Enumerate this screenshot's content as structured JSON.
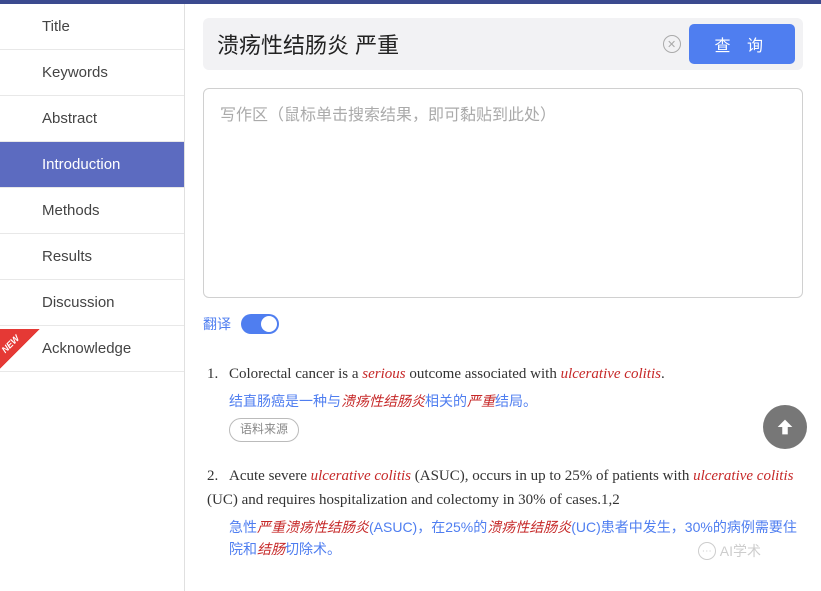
{
  "sidebar": {
    "items": [
      {
        "label": "Title"
      },
      {
        "label": "Keywords"
      },
      {
        "label": "Abstract"
      },
      {
        "label": "Introduction"
      },
      {
        "label": "Methods"
      },
      {
        "label": "Results"
      },
      {
        "label": "Discussion"
      },
      {
        "label": "Acknowledge"
      }
    ],
    "new_badge": "NEW"
  },
  "search": {
    "value": "溃疡性结肠炎 严重",
    "query_btn": "查 询"
  },
  "writearea": {
    "placeholder": "写作区（鼠标单击搜索结果，即可黏贴到此处）"
  },
  "translate": {
    "label": "翻译",
    "on": true
  },
  "source_btn": "语料来源",
  "results": [
    {
      "num": "1.",
      "en_parts": [
        "Colorectal cancer is a ",
        "serious",
        " outcome associated with ",
        "ulcerative colitis",
        "."
      ],
      "en_hl": [
        false,
        true,
        false,
        true,
        false
      ],
      "cn_parts": [
        "结直肠癌是一种与",
        "溃疡性结肠炎",
        "相关的",
        "严重",
        "结局。"
      ],
      "cn_hl": [
        false,
        true,
        false,
        true,
        false
      ]
    },
    {
      "num": "2.",
      "en_parts": [
        "Acute severe ",
        "ulcerative colitis",
        " (ASUC), occurs in up to 25% of patients with ",
        "ulcerative colitis",
        " (UC) and requires hospitalization and colectomy in 30% of cases.1,2"
      ],
      "en_hl": [
        false,
        true,
        false,
        true,
        false
      ],
      "cn_parts": [
        "急性",
        "严重溃疡性结肠炎",
        "(ASUC)，在25%的",
        "溃疡性结肠炎",
        "(UC)患者中发生，30%的病例需要住院和",
        "结肠",
        "切除术。"
      ],
      "cn_hl": [
        false,
        true,
        false,
        true,
        false,
        true,
        false
      ]
    }
  ],
  "watermark": "AI学术"
}
